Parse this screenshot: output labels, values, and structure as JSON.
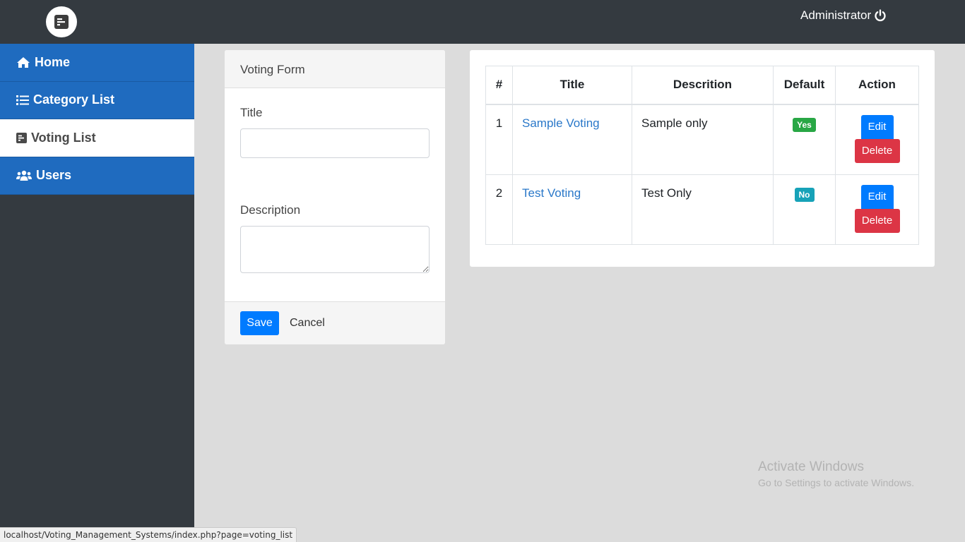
{
  "header": {
    "logo_icon": "poll-h-icon",
    "user_label": "Administrator",
    "logout_icon": "power-icon"
  },
  "sidebar": {
    "items": [
      {
        "label": "Home",
        "icon": "home-icon",
        "active": false
      },
      {
        "label": "Category List",
        "icon": "list-icon",
        "active": false
      },
      {
        "label": "Voting List",
        "icon": "poll-h-icon",
        "active": true
      },
      {
        "label": "Users",
        "icon": "users-icon",
        "active": false
      }
    ]
  },
  "form": {
    "header": "Voting Form",
    "title_label": "Title",
    "title_value": "",
    "description_label": "Description",
    "description_value": "",
    "save_label": "Save",
    "cancel_label": "Cancel"
  },
  "table": {
    "headers": [
      "#",
      "Title",
      "Descrition",
      "Default",
      "Action"
    ],
    "rows": [
      {
        "num": "1",
        "title": "Sample Voting",
        "description": "Sample only",
        "default": "Yes",
        "default_color": "#28a745",
        "edit_label": "Edit",
        "delete_label": "Delete"
      },
      {
        "num": "2",
        "title": "Test Voting",
        "description": "Test Only",
        "default": "No",
        "default_color": "#17a2b8",
        "edit_label": "Edit",
        "delete_label": "Delete"
      }
    ]
  },
  "statusbar": {
    "url": "localhost/Voting_Management_Systems/index.php?page=voting_list"
  },
  "watermark": {
    "line1": "Activate Windows",
    "line2": "Go to Settings to activate Windows."
  },
  "colors": {
    "primary": "#007bff",
    "danger": "#dc3545",
    "sidebar_blue": "#1f6bbf",
    "dark": "#343a40"
  }
}
